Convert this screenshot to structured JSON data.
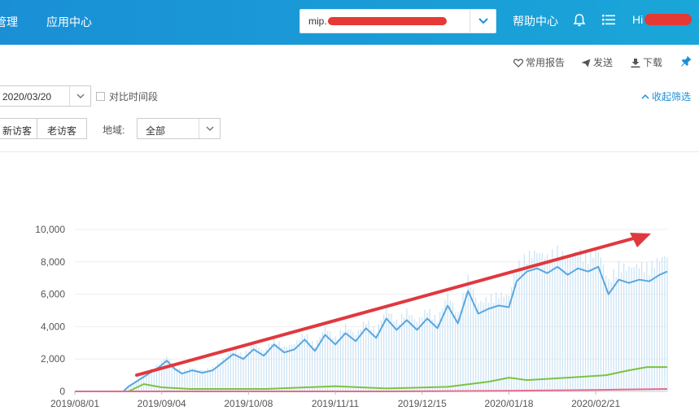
{
  "topbar": {
    "partial_nav_label": "管理",
    "app_center_label": "应用中心",
    "site_selector_value": "mip.",
    "help_center_label": "帮助中心",
    "user_greeting": "Hi",
    "colors": {
      "bar": "#1a9bd7",
      "redaction": "#e53935"
    }
  },
  "toolbar": {
    "common_reports_label": "常用报告",
    "send_label": "发送",
    "download_label": "下载"
  },
  "filters": {
    "date_value": "2020/03/20",
    "compare_label": "对比时间段",
    "collapse_label": "收起筛选",
    "new_visitor_label": "新访客",
    "old_visitor_label": "老访客",
    "region_label": "地域:",
    "region_value": "全部"
  },
  "chart_data": {
    "type": "line",
    "y_ticks": [
      "10,000",
      "8,000",
      "6,000",
      "4,000",
      "2,000",
      "0"
    ],
    "x_ticks": [
      "2019/08/01",
      "2019/09/04",
      "2019/10/08",
      "2019/11/11",
      "2019/12/15",
      "2020/01/18",
      "2020/02/21"
    ],
    "ylim": [
      0,
      10000
    ],
    "x_start": "2019/08/01",
    "x_end": "2020/03/20",
    "grid": true,
    "colors": {
      "blue": "#5aa7de",
      "green": "#7cc242",
      "pink": "#e76c8a",
      "bars": "#c9e2f4",
      "trend_arrow": "#e0383e"
    },
    "series": [
      {
        "values": [
          [
            "2019/08/01",
            0
          ],
          [
            "2019/08/20",
            0
          ],
          [
            "2019/08/22",
            300
          ],
          [
            "2019/08/25",
            600
          ],
          [
            "2019/08/28",
            900
          ],
          [
            "2019/08/31",
            1200
          ],
          [
            "2019/09/03",
            1500
          ],
          [
            "2019/09/06",
            1900
          ],
          [
            "2019/09/09",
            1400
          ],
          [
            "2019/09/12",
            1100
          ],
          [
            "2019/09/16",
            1300
          ],
          [
            "2019/09/20",
            1150
          ],
          [
            "2019/09/24",
            1300
          ],
          [
            "2019/09/28",
            1800
          ],
          [
            "2019/10/02",
            2300
          ],
          [
            "2019/10/06",
            2000
          ],
          [
            "2019/10/10",
            2600
          ],
          [
            "2019/10/14",
            2200
          ],
          [
            "2019/10/18",
            2900
          ],
          [
            "2019/10/22",
            2400
          ],
          [
            "2019/10/26",
            2600
          ],
          [
            "2019/10/30",
            3200
          ],
          [
            "2019/11/03",
            2500
          ],
          [
            "2019/11/07",
            3500
          ],
          [
            "2019/11/11",
            2900
          ],
          [
            "2019/11/15",
            3600
          ],
          [
            "2019/11/19",
            3100
          ],
          [
            "2019/11/23",
            3900
          ],
          [
            "2019/11/27",
            3300
          ],
          [
            "2019/12/01",
            4500
          ],
          [
            "2019/12/05",
            3800
          ],
          [
            "2019/12/09",
            4400
          ],
          [
            "2019/12/13",
            3800
          ],
          [
            "2019/12/17",
            4500
          ],
          [
            "2019/12/21",
            3900
          ],
          [
            "2019/12/25",
            5300
          ],
          [
            "2019/12/29",
            4200
          ],
          [
            "2020/01/02",
            6200
          ],
          [
            "2020/01/06",
            4800
          ],
          [
            "2020/01/10",
            5100
          ],
          [
            "2020/01/14",
            5300
          ],
          [
            "2020/01/18",
            5200
          ],
          [
            "2020/01/21",
            6800
          ],
          [
            "2020/01/25",
            7400
          ],
          [
            "2020/01/29",
            7600
          ],
          [
            "2020/02/02",
            7300
          ],
          [
            "2020/02/06",
            7700
          ],
          [
            "2020/02/10",
            7200
          ],
          [
            "2020/02/14",
            7600
          ],
          [
            "2020/02/18",
            7400
          ],
          [
            "2020/02/22",
            7700
          ],
          [
            "2020/02/26",
            6000
          ],
          [
            "2020/03/01",
            6900
          ],
          [
            "2020/03/05",
            6700
          ],
          [
            "2020/03/09",
            6900
          ],
          [
            "2020/03/13",
            6800
          ],
          [
            "2020/03/17",
            7200
          ],
          [
            "2020/03/20",
            7400
          ]
        ]
      },
      {
        "values": [
          [
            "2019/08/01",
            0
          ],
          [
            "2019/08/22",
            0
          ],
          [
            "2019/08/28",
            450
          ],
          [
            "2019/09/04",
            250
          ],
          [
            "2019/09/15",
            150
          ],
          [
            "2019/10/15",
            150
          ],
          [
            "2019/11/11",
            320
          ],
          [
            "2019/12/01",
            180
          ],
          [
            "2019/12/25",
            280
          ],
          [
            "2020/01/10",
            600
          ],
          [
            "2020/01/18",
            850
          ],
          [
            "2020/01/25",
            700
          ],
          [
            "2020/02/10",
            850
          ],
          [
            "2020/02/25",
            1000
          ],
          [
            "2020/03/05",
            1300
          ],
          [
            "2020/03/12",
            1500
          ],
          [
            "2020/03/20",
            1500
          ]
        ]
      },
      {
        "values": [
          [
            "2019/08/01",
            0
          ],
          [
            "2019/12/01",
            0
          ],
          [
            "2020/01/18",
            40
          ],
          [
            "2020/02/21",
            90
          ],
          [
            "2020/03/20",
            150
          ]
        ]
      }
    ]
  }
}
